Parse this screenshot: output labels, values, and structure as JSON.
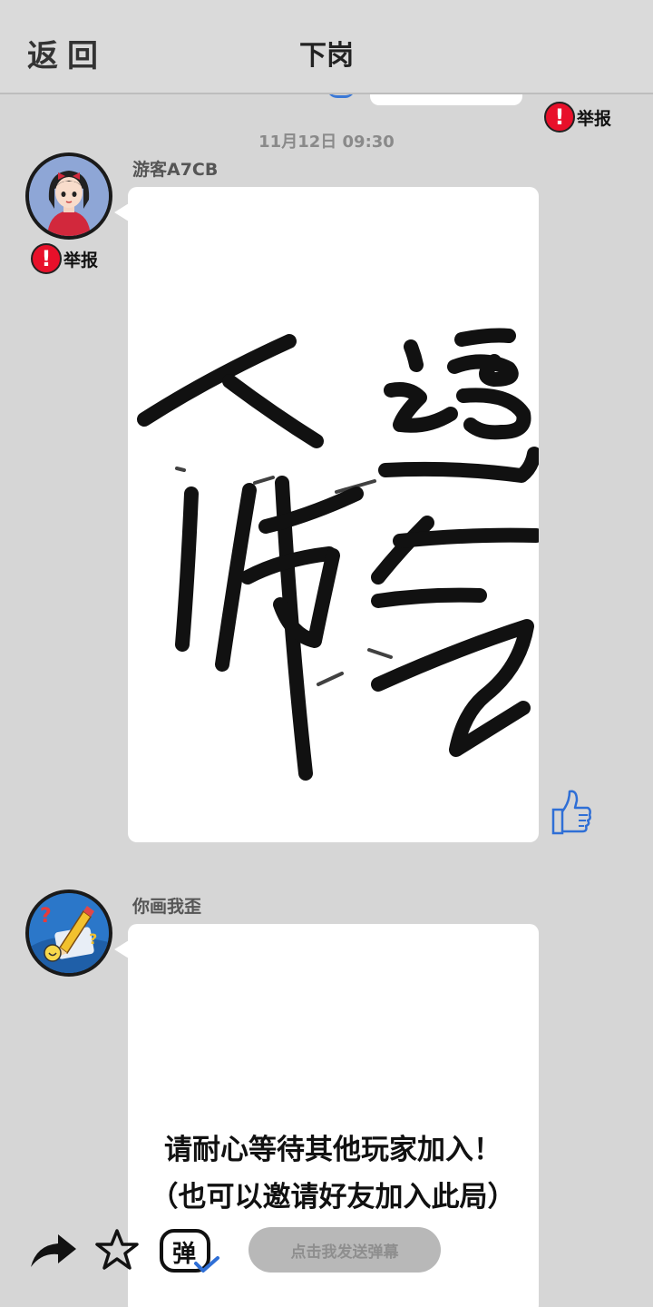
{
  "header": {
    "back_label": "返回",
    "title": "下岗"
  },
  "report_label": "举报",
  "report_badge": "!",
  "timestamp": "11月12日  09:30",
  "messages": [
    {
      "sender": "游客A7CB",
      "content": "drawing",
      "drawing_text": "人逼 佈气",
      "avatar_icon": "girl-avatar-icon"
    },
    {
      "sender": "你画我歪",
      "avatar_icon": "pencil-logo-icon"
    }
  ],
  "waiting": {
    "line1": "请耐心等待其他玩家加入！",
    "line2": "（也可以邀请好友加入此局）"
  },
  "toolbar": {
    "danmu_badge": "弹",
    "danmu_placeholder": "点击我发送弹幕"
  },
  "colors": {
    "background": "#d6d6d6",
    "report_red": "#e8102a",
    "like_blue": "#2f6fd6"
  }
}
